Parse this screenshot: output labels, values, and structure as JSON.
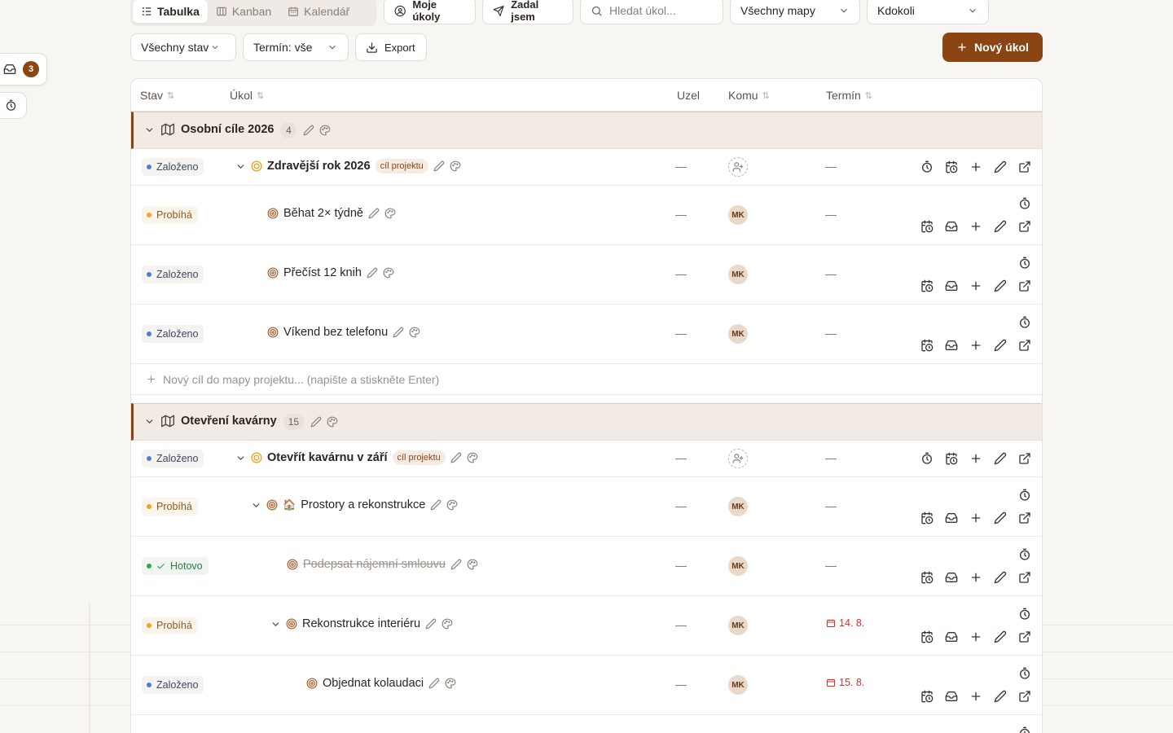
{
  "view_tabs": [
    {
      "label": "Tabulka",
      "icon": "table-icon",
      "active": true
    },
    {
      "label": "Kanban",
      "icon": "kanban-icon",
      "active": false
    },
    {
      "label": "Kalendář",
      "icon": "calendar-icon",
      "active": false
    }
  ],
  "toolbar": {
    "my_tasks": "Moje úkoly",
    "assigned_by_me": "Zadal jsem",
    "search_placeholder": "Hledat úkol...",
    "maps_select": "Všechny mapy",
    "assignee_select": "Kdokoli",
    "status_select": "Všechny stav",
    "due_select": "Termín: vše",
    "export": "Export",
    "new_task": "Nový úkol"
  },
  "floating": {
    "inbox_count": "3"
  },
  "columns": {
    "stav": "Stav",
    "ukol": "Úkol",
    "uzel": "Uzel",
    "komu": "Komu",
    "termin": "Termín"
  },
  "groups": [
    {
      "title": "Osobní cíle 2026",
      "count": "4",
      "new_goal_placeholder": "Nový cíl do mapy projektu... (napište a stiskněte Enter)",
      "rows": [
        {
          "status": "Založeno",
          "name": "Zdravější rok 2026",
          "tag": "cíl projektu",
          "node": "—",
          "assignee": "",
          "due": "—"
        },
        {
          "status": "Probíhá",
          "name": "Běhat 2× týdně",
          "node": "—",
          "assignee": "MK",
          "due": "—"
        },
        {
          "status": "Založeno",
          "name": "Přečíst 12 knih",
          "node": "—",
          "assignee": "MK",
          "due": "—"
        },
        {
          "status": "Založeno",
          "name": "Víkend bez telefonu",
          "node": "—",
          "assignee": "MK",
          "due": "—"
        }
      ]
    },
    {
      "title": "Otevření kavárny",
      "count": "15",
      "rows": [
        {
          "status": "Založeno",
          "name": "Otevřít kavárnu v září",
          "tag": "cíl projektu",
          "node": "—",
          "assignee": "",
          "due": "—"
        },
        {
          "status": "Probíhá",
          "name": "Prostory a rekonstrukce",
          "emoji": "🏠",
          "node": "—",
          "assignee": "MK",
          "due": "—"
        },
        {
          "status": "Hotovo",
          "name": "Podepsat nájemní smlouvu",
          "node": "—",
          "assignee": "MK",
          "due": "—"
        },
        {
          "status": "Probíhá",
          "name": "Rekonstrukce interiéru",
          "node": "—",
          "assignee": "MK",
          "due": "14. 8."
        },
        {
          "status": "Založeno",
          "name": "Objednat kolaudaci",
          "node": "—",
          "assignee": "MK",
          "due": "15. 8."
        }
      ]
    }
  ],
  "colors": {
    "accent": "#8b4513",
    "overdue": "#d0342c",
    "zalozeno_dot": "#4a7fd4",
    "probiha_dot": "#f0a22a",
    "hotovo_dot": "#35a15a"
  }
}
